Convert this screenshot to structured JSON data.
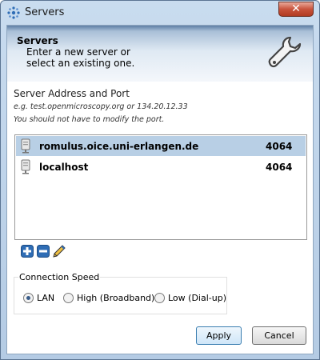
{
  "window": {
    "title": "Servers",
    "close_label": "✕"
  },
  "header": {
    "title": "Servers",
    "subtitle": "Enter a new server or select an existing one."
  },
  "section": {
    "title": "Server Address and Port",
    "example_hint": "e.g. test.openmicroscopy.org or 134.20.12.33",
    "port_hint": "You should not have to modify the port."
  },
  "servers": [
    {
      "name": "romulus.oice.uni-erlangen.de",
      "port": "4064",
      "selected": true
    },
    {
      "name": "localhost",
      "port": "4064",
      "selected": false
    }
  ],
  "toolbar": {
    "add_icon": "plus-icon",
    "remove_icon": "minus-icon",
    "edit_icon": "pencil-icon"
  },
  "connection_speed": {
    "label": "Connection Speed",
    "options": [
      {
        "label": "LAN",
        "selected": true
      },
      {
        "label": "High (Broadband)",
        "selected": false
      },
      {
        "label": "Low (Dial-up)",
        "selected": false
      }
    ]
  },
  "buttons": {
    "apply": "Apply",
    "cancel": "Cancel"
  },
  "colors": {
    "selection": "#b8cfe5",
    "accent": "#3c7fb1"
  }
}
